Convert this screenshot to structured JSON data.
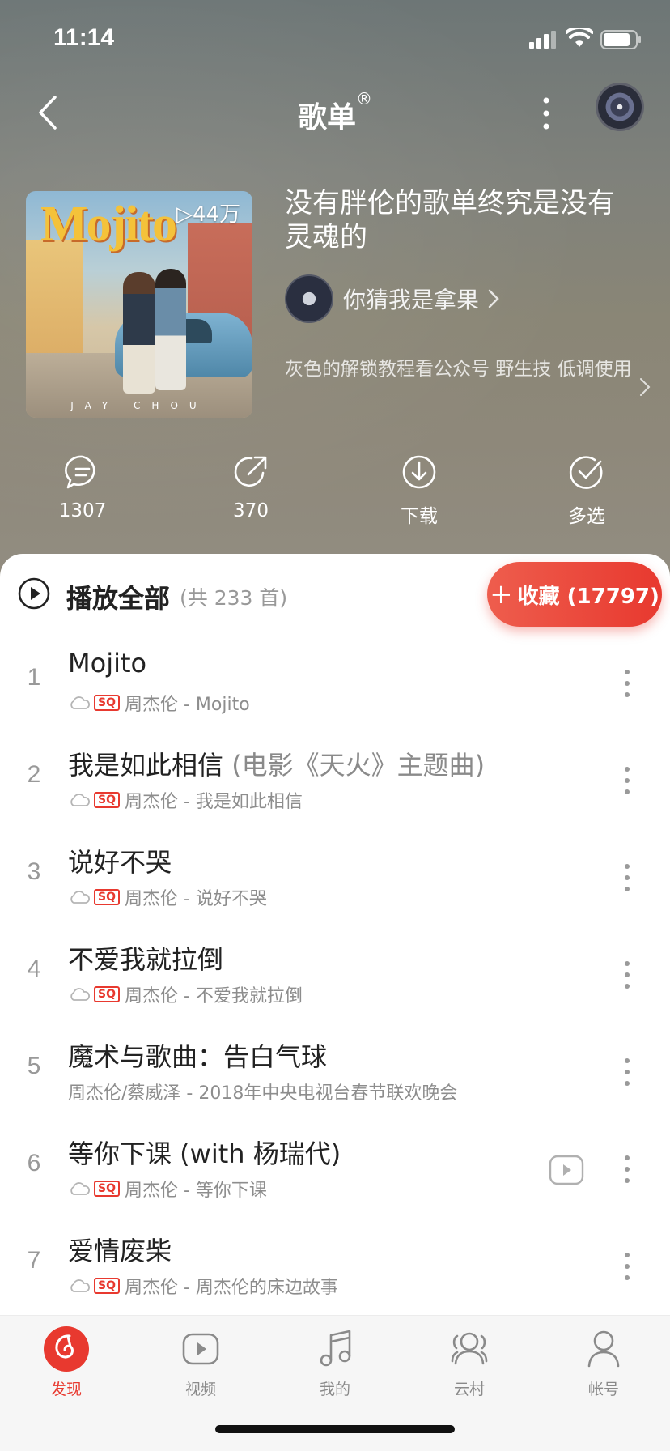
{
  "status_bar": {
    "time": "11:14"
  },
  "header": {
    "title": "歌单",
    "title_mark": "®"
  },
  "playlist": {
    "cover_title": "Mojito",
    "cover_artist": "JAY CHOU",
    "play_count": "44万",
    "name": "没有胖伦的歌单终究是没有灵魂的",
    "creator": "你猜我是拿果",
    "description": "灰色的解锁教程看公众号 野生技 低调使用"
  },
  "actions": {
    "comment_count": "1307",
    "share_count": "370",
    "download_label": "下载",
    "multiselect_label": "多选"
  },
  "list_header": {
    "play_all_label": "播放全部",
    "song_count": "(共 233 首)",
    "collect_label": "收藏 (17797)"
  },
  "songs": [
    {
      "index": "1",
      "name": "Mojito",
      "alias": "",
      "sq": "SQ",
      "subtitle": "周杰伦 - Mojito"
    },
    {
      "index": "2",
      "name": "我是如此相信",
      "alias": " (电影《天火》主题曲)",
      "sq": "SQ",
      "subtitle": "周杰伦 - 我是如此相信"
    },
    {
      "index": "3",
      "name": "说好不哭",
      "alias": "",
      "sq": "SQ",
      "subtitle": "周杰伦 - 说好不哭"
    },
    {
      "index": "4",
      "name": "不爱我就拉倒",
      "alias": "",
      "sq": "SQ",
      "subtitle": "周杰伦 - 不爱我就拉倒"
    },
    {
      "index": "5",
      "name": "魔术与歌曲：告白气球",
      "alias": "",
      "sq": "",
      "subtitle": "周杰伦/蔡威泽 - 2018年中央电视台春节联欢晚会"
    },
    {
      "index": "6",
      "name": "等你下课 (with 杨瑞代)",
      "alias": "",
      "sq": "SQ",
      "subtitle": "周杰伦 - 等你下课"
    },
    {
      "index": "7",
      "name": "爱情废柴",
      "alias": "",
      "sq": "SQ",
      "subtitle": "周杰伦 - 周杰伦的床边故事"
    }
  ],
  "tabbar": {
    "discover": "发现",
    "video": "视频",
    "mine": "我的",
    "cloud_village": "云村",
    "account": "帐号"
  },
  "colors": {
    "accent": "#e8392f",
    "text_primary": "#222222",
    "text_secondary": "#8d8d8d"
  }
}
